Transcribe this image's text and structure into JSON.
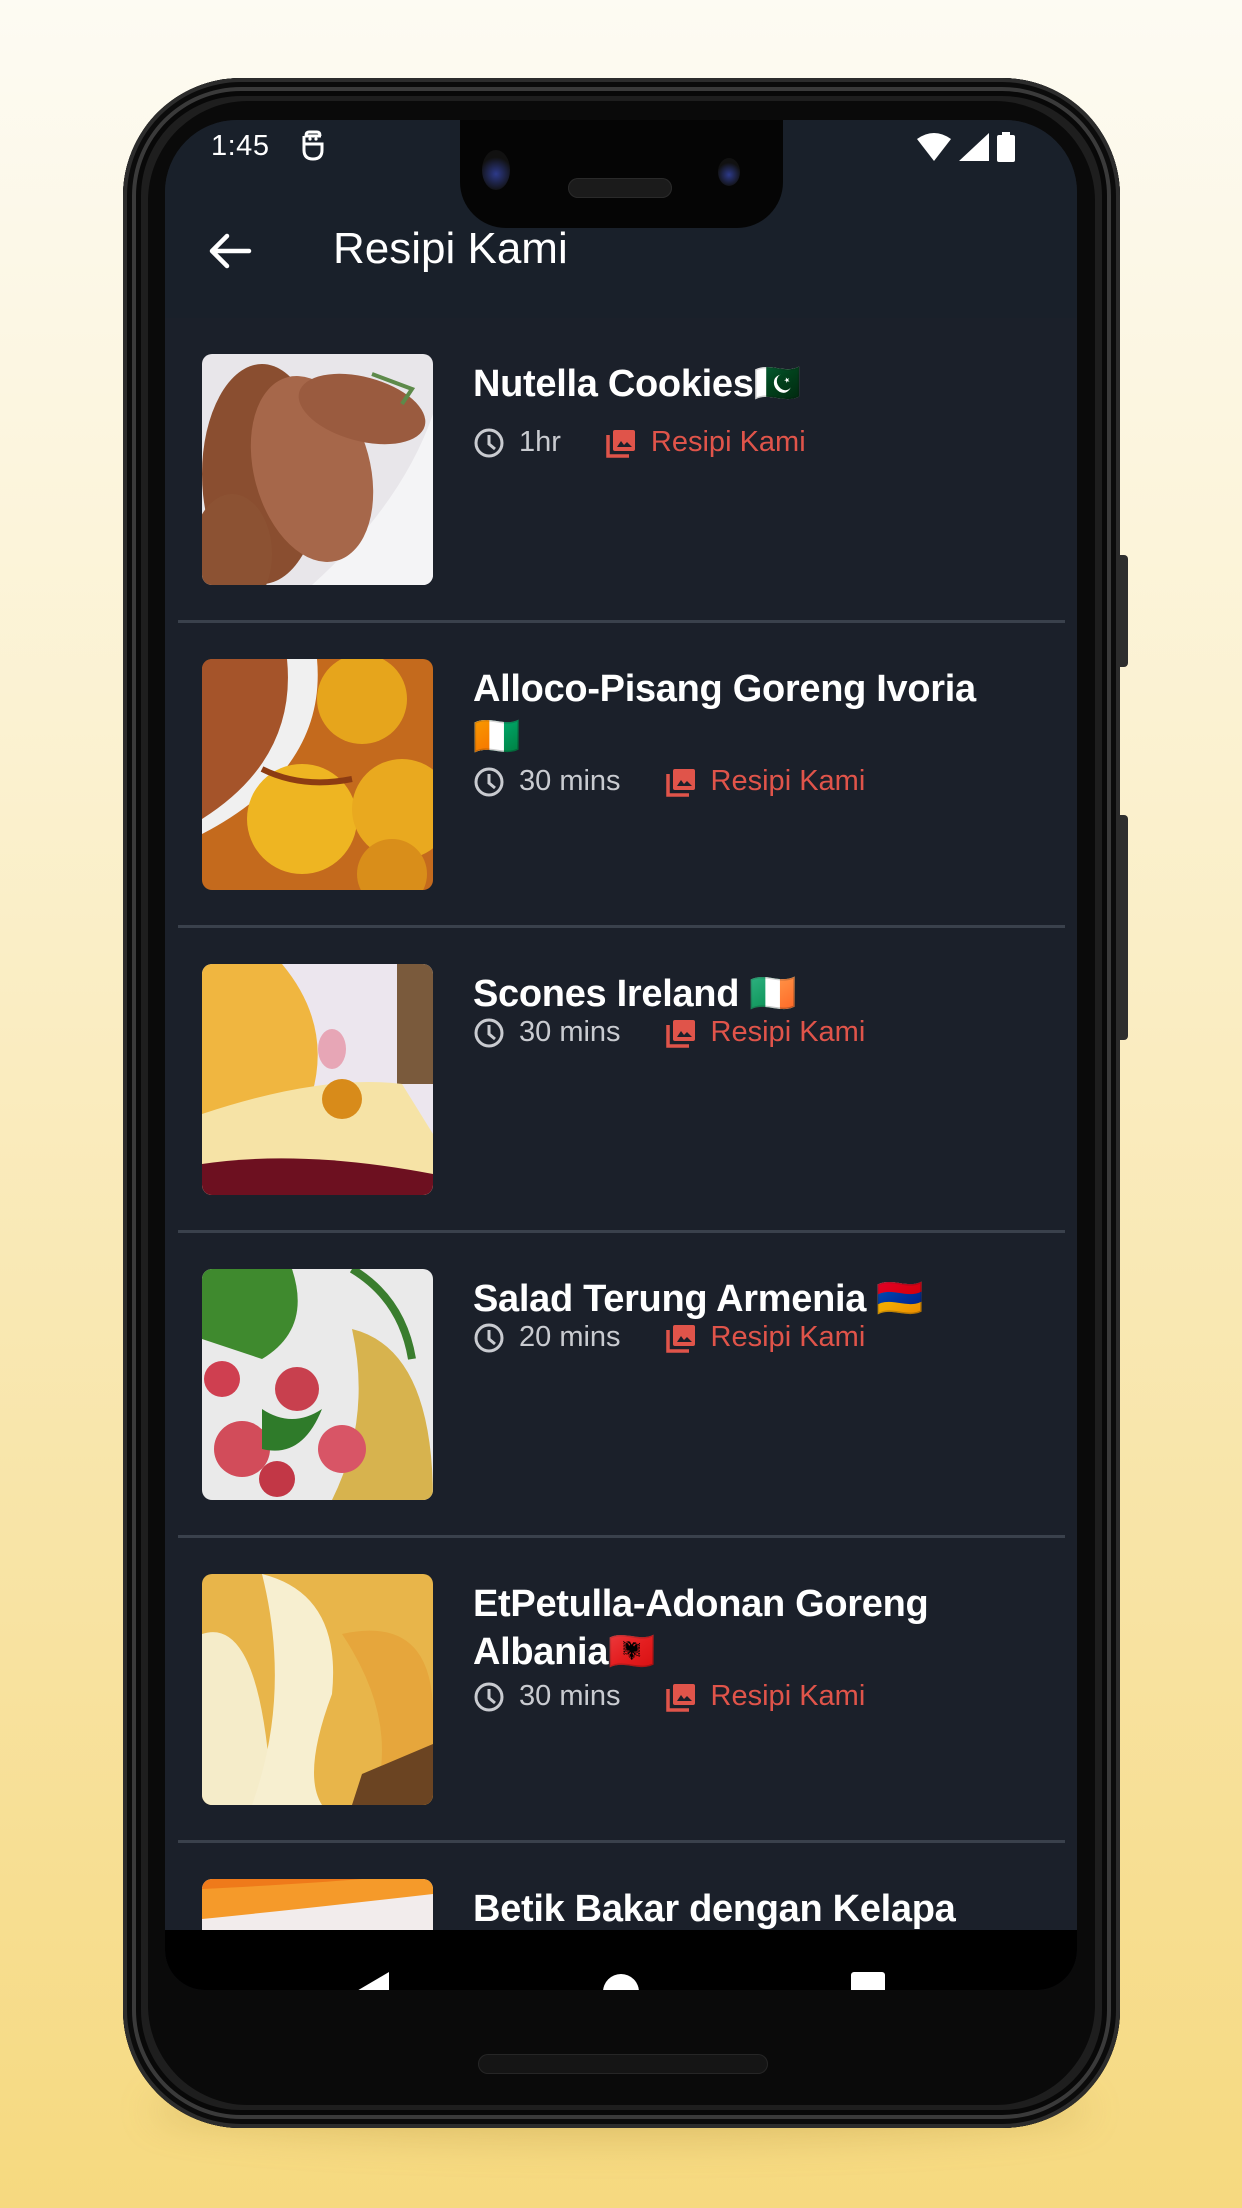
{
  "status_bar": {
    "time": "1:45",
    "notification_icon": "debug-robot-icon",
    "wifi_icon": "wifi-icon",
    "signal_icon": "cellular-signal-icon",
    "battery_icon": "battery-full-icon"
  },
  "app_bar": {
    "back_icon": "arrow-back-icon",
    "title": "Resipi Kami"
  },
  "colors": {
    "background": "#1b202a",
    "accent": "#e0544a",
    "meta_text": "#c9cbd0",
    "title_text": "#ffffff",
    "divider": "#3a414c"
  },
  "recipes": [
    {
      "title": "Nutella Cookies🇵🇰",
      "time": "1hr",
      "source": "Resipi Kami"
    },
    {
      "title": "Alloco-Pisang Goreng Ivoria 🇨🇮",
      "time": "30 mins",
      "source": "Resipi Kami"
    },
    {
      "title": "Scones Ireland 🇮🇪",
      "time": "30 mins",
      "source": "Resipi Kami"
    },
    {
      "title": "Salad Terung Armenia 🇦🇲",
      "time": "20 mins",
      "source": "Resipi Kami"
    },
    {
      "title": "EtPetulla-Adonan Goreng Albania🇦🇱",
      "time": "30 mins",
      "source": "Resipi Kami"
    },
    {
      "title": "Betik Bakar dengan Kelapa",
      "time": "",
      "source": ""
    }
  ],
  "nav_bar": {
    "back": "nav-back-icon",
    "home": "nav-home-icon",
    "recents": "nav-recents-icon"
  }
}
